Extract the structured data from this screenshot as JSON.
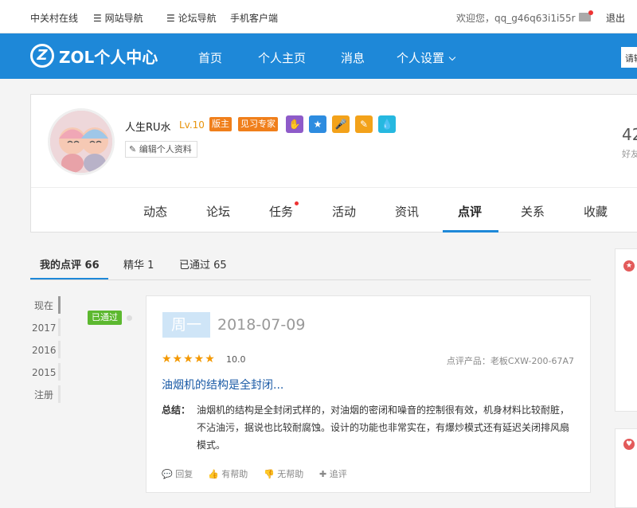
{
  "topbar": {
    "links": [
      "中关村在线",
      "网站导航",
      "论坛导航",
      "手机客户端"
    ],
    "welcome": "欢迎您，qq_g46q63i1i55r",
    "logout": "退出"
  },
  "nav": {
    "logo_text": "ZOL个人中心",
    "items": [
      "首页",
      "个人主页",
      "消息",
      "个人设置"
    ],
    "search_placeholder": "请输"
  },
  "profile": {
    "username": "人生RU水",
    "level": "Lv.10",
    "badges": [
      "版主",
      "见习专家"
    ],
    "edit_label": "编辑个人资料",
    "stat_value": "42",
    "stat_label": "好友",
    "tabs": [
      "动态",
      "论坛",
      "任务",
      "活动",
      "资讯",
      "点评",
      "关系",
      "收藏"
    ]
  },
  "subtabs": [
    "我的点评 66",
    "精华 1",
    "已通过 65"
  ],
  "timeline": [
    "现在",
    "2017",
    "2016",
    "2015",
    "注册"
  ],
  "review": {
    "status": "已通过",
    "weekday": "周一",
    "date": "2018-07-09",
    "stars": "★★★★★",
    "score": "10.0",
    "product": "点评产品：老板CXW-200-67A7",
    "title": "油烟机的结构是全封闭...",
    "summary_label": "总结：",
    "summary": "油烟机的结构是全封闭式样的，对油烟的密闭和噪音的控制很有效，机身材料比较耐脏，不沾油污，据说也比较耐腐蚀。设计的功能也非常实在，有爆炒模式还有延迟关闭排风扇模式。",
    "actions": [
      "回复",
      "有帮助",
      "无帮助",
      "追评"
    ]
  },
  "colors": {
    "brand": "#1e88d8",
    "pass": "#5cb82f",
    "star": "#f39800",
    "link": "#1a5aa6"
  }
}
